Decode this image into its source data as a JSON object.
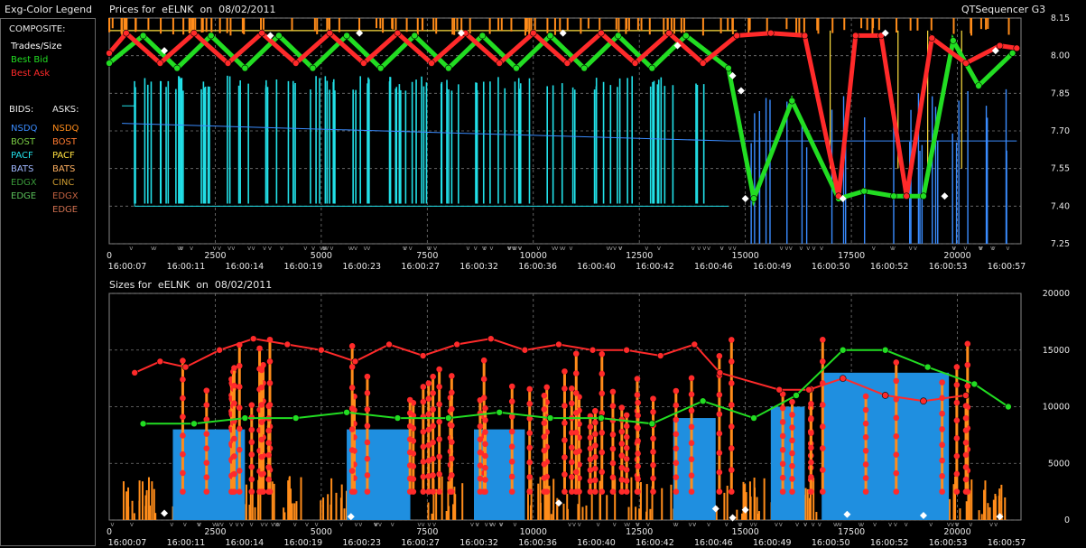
{
  "window": {
    "legend_title": "Exg-Color Legend",
    "app_name": "QTSequencer G3"
  },
  "legend": {
    "composite_header": "COMPOSITE:",
    "composite": [
      {
        "label": "Trades/Size",
        "color": "#ffffff"
      },
      {
        "label": "Best Bid",
        "color": "#22dd22"
      },
      {
        "label": "Best Ask",
        "color": "#ff2a2a"
      }
    ],
    "bids_header": "BIDS:",
    "asks_header": "ASKS:",
    "bids": [
      {
        "label": "NSDQ",
        "color": "#3a8cff"
      },
      {
        "label": "BOST",
        "color": "#7acc44"
      },
      {
        "label": "PACF",
        "color": "#22e0e8"
      },
      {
        "label": "BATS",
        "color": "#a0b8ff"
      },
      {
        "label": "EDGX",
        "color": "#3a9a3a"
      },
      {
        "label": "EDGE",
        "color": "#5abf5a"
      }
    ],
    "asks": [
      {
        "label": "NSDQ",
        "color": "#ff8c1a"
      },
      {
        "label": "BOST",
        "color": "#ff7a30"
      },
      {
        "label": "PACF",
        "color": "#ffe040"
      },
      {
        "label": "BATS",
        "color": "#ffb060"
      },
      {
        "label": "CINC",
        "color": "#cc9a30"
      },
      {
        "label": "EDGX",
        "color": "#c06040"
      },
      {
        "label": "EDGE",
        "color": "#d07050"
      }
    ]
  },
  "chart_data": [
    {
      "type": "line",
      "title": "Prices for  eELNK  on  08/02/2011",
      "ylim": [
        7.25,
        8.15
      ],
      "y_ticks": [
        "8.15",
        "8.00",
        "7.85",
        "7.70",
        "7.55",
        "7.40",
        "7.25"
      ],
      "xlim": [
        0,
        21500
      ],
      "x_ticks": [
        "0",
        "2500",
        "5000",
        "7500",
        "10000",
        "12500",
        "15000",
        "17500",
        "20000"
      ],
      "time_labels": [
        "16:00:07",
        "16:00:11",
        "16:00:14",
        "16:00:19",
        "16:00:23",
        "16:00:27",
        "16:00:32",
        "16:00:36",
        "16:00:40",
        "16:00:42",
        "16:00:46",
        "16:00:49",
        "16:00:50",
        "16:00:52",
        "16:00:53",
        "16:00:57"
      ],
      "grid": true,
      "series": [
        {
          "name": "Best Bid",
          "color": "#22dd22",
          "x": [
            0,
            800,
            1600,
            2400,
            3200,
            4000,
            4800,
            5600,
            6400,
            7200,
            8000,
            8800,
            9600,
            10400,
            11200,
            12000,
            12800,
            13600,
            14600,
            15200,
            16100,
            17200,
            17800,
            18500,
            19200,
            19900,
            20500,
            21300
          ],
          "values": [
            7.97,
            8.08,
            7.95,
            8.08,
            7.95,
            8.08,
            7.95,
            8.08,
            7.95,
            8.08,
            7.95,
            8.08,
            7.95,
            8.08,
            7.95,
            8.08,
            7.95,
            8.08,
            7.95,
            7.43,
            7.82,
            7.43,
            7.46,
            7.44,
            7.44,
            8.06,
            7.88,
            8.01
          ]
        },
        {
          "name": "Best Ask",
          "color": "#ff2a2a",
          "x": [
            0,
            400,
            1200,
            2000,
            2800,
            3600,
            4400,
            5200,
            6000,
            6800,
            7600,
            8400,
            9200,
            10000,
            10800,
            11600,
            12400,
            13200,
            14000,
            14800,
            15600,
            16400,
            17200,
            17600,
            18200,
            18800,
            19400,
            20200,
            21000,
            21400
          ],
          "values": [
            8.01,
            8.09,
            7.97,
            8.09,
            7.97,
            8.09,
            7.97,
            8.09,
            7.97,
            8.09,
            7.97,
            8.09,
            7.97,
            8.09,
            7.97,
            8.09,
            7.97,
            8.09,
            7.97,
            8.08,
            8.09,
            8.08,
            7.44,
            8.08,
            8.08,
            7.44,
            8.07,
            7.97,
            8.04,
            8.03
          ]
        }
      ]
    },
    {
      "type": "bar",
      "title": "Sizes for  eELNK  on  08/02/2011",
      "ylim": [
        0,
        20000
      ],
      "y_ticks": [
        "20000",
        "15000",
        "10000",
        "5000",
        "0"
      ],
      "xlim": [
        0,
        21500
      ],
      "x_ticks": [
        "0",
        "2500",
        "5000",
        "7500",
        "10000",
        "12500",
        "15000",
        "17500",
        "20000"
      ],
      "time_labels": [
        "16:00:07",
        "16:00:11",
        "16:00:14",
        "16:00:19",
        "16:00:23",
        "16:00:27",
        "16:00:32",
        "16:00:36",
        "16:00:40",
        "16:00:42",
        "16:00:46",
        "16:00:49",
        "16:00:50",
        "16:00:52",
        "16:00:53",
        "16:00:57"
      ],
      "grid": true,
      "series": [
        {
          "name": "Best Ask",
          "color": "#ff2a2a",
          "x": [
            600,
            1200,
            1800,
            2600,
            3400,
            4200,
            5000,
            5800,
            6600,
            7400,
            8200,
            9000,
            9800,
            10600,
            11400,
            12200,
            13000,
            13800,
            14400,
            15800,
            16500,
            17300,
            18300,
            19200,
            20200
          ],
          "values": [
            13000,
            14000,
            13500,
            15000,
            16000,
            15500,
            15000,
            14000,
            15500,
            14500,
            15500,
            16000,
            15000,
            15500,
            15000,
            15000,
            14500,
            15500,
            13000,
            11500,
            11500,
            12500,
            11000,
            10500,
            11000
          ]
        },
        {
          "name": "Best Bid",
          "color": "#22dd22",
          "x": [
            800,
            2000,
            3200,
            4400,
            5600,
            6800,
            8000,
            9200,
            10400,
            11600,
            12800,
            14000,
            15200,
            16200,
            17300,
            18300,
            19300,
            20400,
            21200
          ],
          "values": [
            8500,
            8500,
            9000,
            9000,
            9500,
            9000,
            9000,
            9500,
            9000,
            9000,
            8500,
            10500,
            9000,
            11000,
            15000,
            15000,
            13500,
            12000,
            10000
          ]
        }
      ]
    }
  ]
}
